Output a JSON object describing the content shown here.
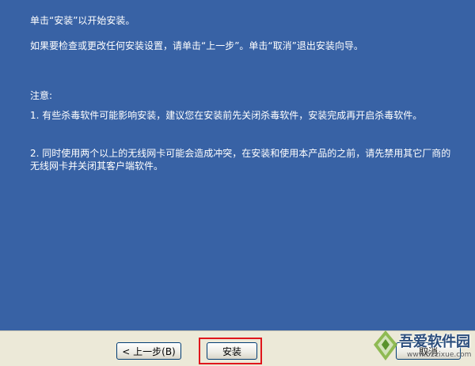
{
  "content": {
    "line1": "单击“安装”以开始安装。",
    "line2": "如果要检查或更改任何安装设置，请单击“上一步”。单击“取消”退出安装向导。",
    "notice_heading": "注意:",
    "notice_1": "1. 有些杀毒软件可能影响安装，建议您在安装前先关闭杀毒软件，安装完成再开启杀毒软件。",
    "notice_2": "2. 同时使用两个以上的无线网卡可能会造成冲突，在安装和使用本产品的之前，请先禁用其它厂商的无线网卡并关闭其客户端软件。"
  },
  "buttons": {
    "back_label": "< 上一步(B)",
    "install_label": "安装",
    "cancel_label": "取消"
  },
  "watermark": {
    "brand": "吾爱软件园",
    "url": "www.52zixue.com"
  },
  "colors": {
    "background": "#3862a5",
    "highlight": "#e0161c",
    "bar": "#ece9d8"
  }
}
